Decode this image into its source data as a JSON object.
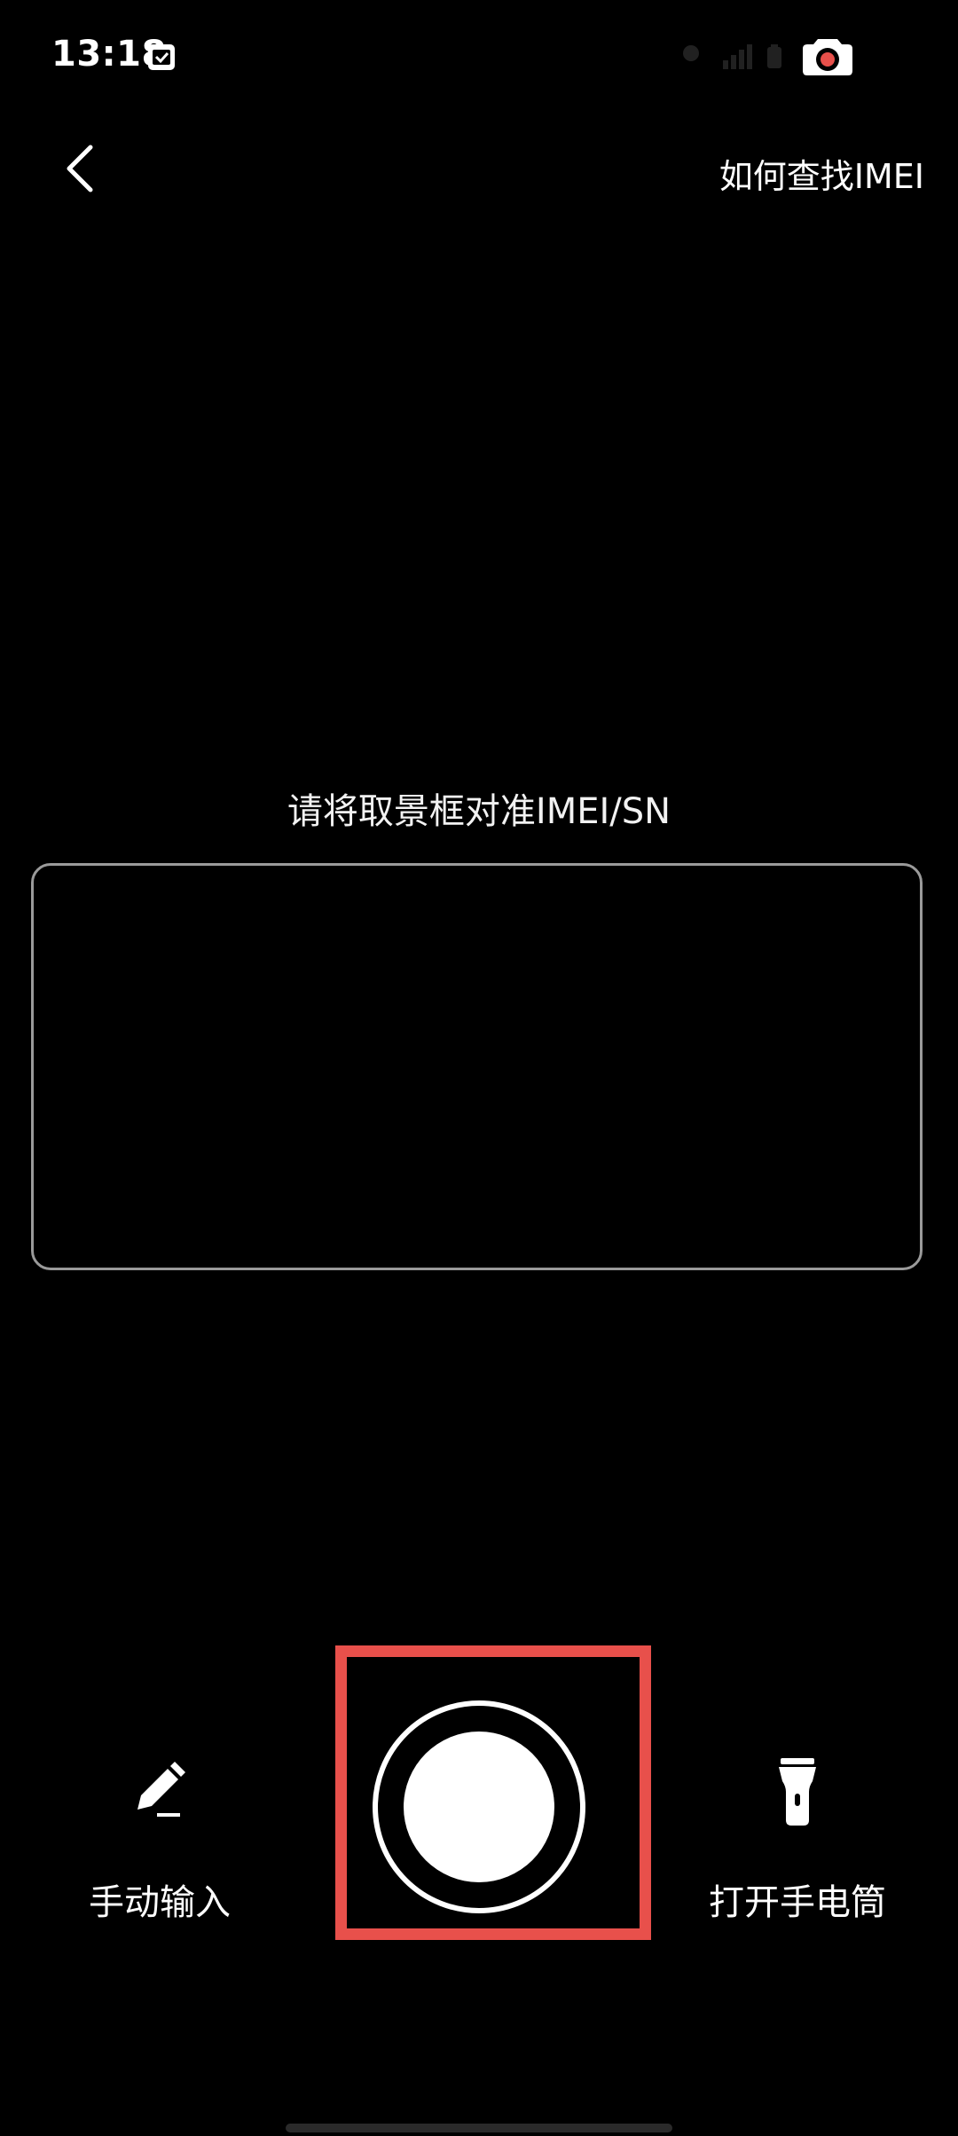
{
  "status_bar": {
    "time": "13:18",
    "icons": [
      "calendar-notification-icon",
      "location-icon",
      "signal-icon",
      "battery-icon",
      "camera-indicator-icon"
    ],
    "camera_dot_color": "#e8504b"
  },
  "header": {
    "back_icon": "chevron-left-icon",
    "help_link": "如何查找IMEI"
  },
  "scanner": {
    "hint": "请将取景框对准IMEI/SN"
  },
  "actions": {
    "manual_input": {
      "icon": "pencil-icon",
      "label": "手动输入"
    },
    "shutter": {
      "icon": "shutter-button",
      "highlight_color": "#e8504b"
    },
    "flashlight": {
      "icon": "flashlight-icon",
      "label": "打开手电筒"
    }
  }
}
